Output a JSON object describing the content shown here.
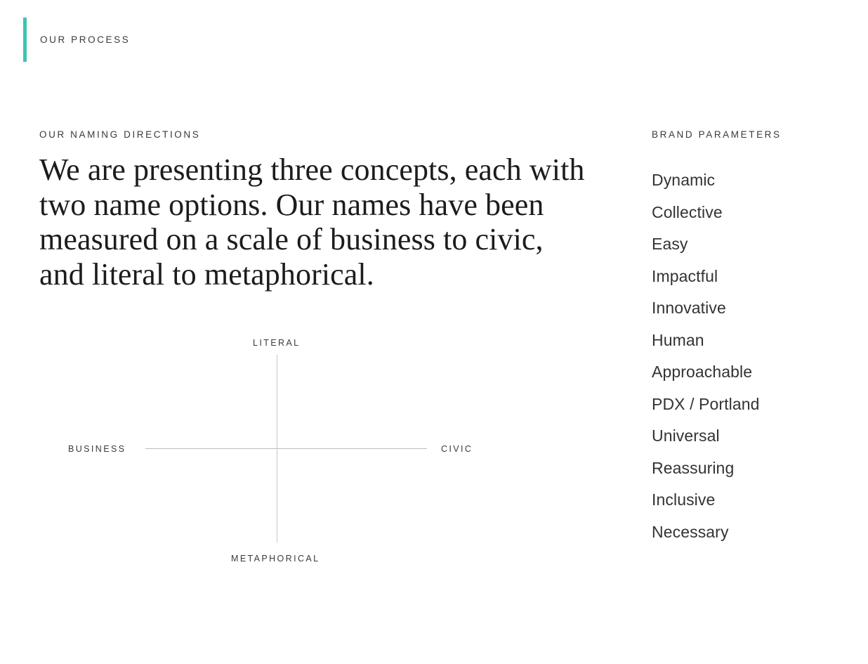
{
  "header": {
    "eyebrow": "OUR PROCESS",
    "accent_color": "#3cc4b4"
  },
  "left": {
    "eyebrow": "OUR NAMING DIRECTIONS",
    "headline": "We are presenting three concepts, each with two name options. Our names have been measured on a scale of business to civic, and literal to metaphorical."
  },
  "matrix": {
    "top_label": "LITERAL",
    "bottom_label": "METAPHORICAL",
    "left_label": "BUSINESS",
    "right_label": "CIVIC",
    "line_color": "#bcbcbc"
  },
  "right": {
    "eyebrow": "BRAND PARAMETERS",
    "parameters": [
      "Dynamic",
      "Collective",
      "Easy",
      "Impactful",
      "Innovative",
      "Human",
      "Approachable",
      "PDX / Portland",
      "Universal",
      "Reassuring",
      "Inclusive",
      "Necessary"
    ]
  }
}
